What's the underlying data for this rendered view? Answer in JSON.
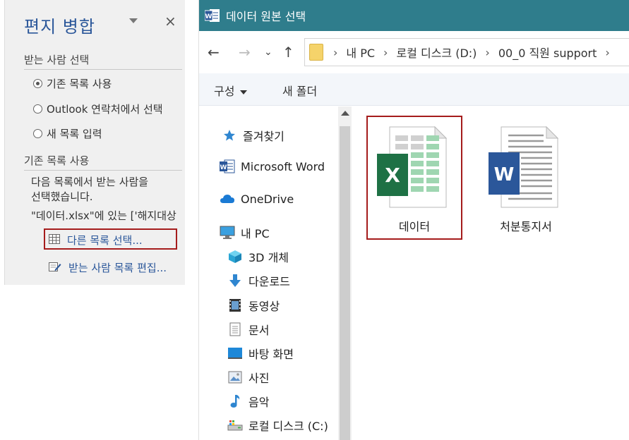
{
  "mail_merge": {
    "title": "편지 병합",
    "close": "×",
    "section_recipients": "받는 사람 선택",
    "options": [
      {
        "label": "기존 목록 사용",
        "selected": true
      },
      {
        "label": "Outlook 연락처에서 선택",
        "selected": false
      },
      {
        "label": "새 목록 입력",
        "selected": false
      }
    ],
    "section_existing": "기존 목록 사용",
    "desc_line1": "다음 목록에서 받는 사람을",
    "desc_line2": "선택했습니다.",
    "desc_line3": "\"데이터.xlsx\"에 있는 ['해지대상",
    "link_select": "다른 목록 선택...",
    "link_edit": "받는 사람 목록 편집..."
  },
  "dialog": {
    "title": "데이터 원본 선택",
    "path": [
      "내 PC",
      "로컬 디스크 (D:)",
      "00_0 직원 support"
    ],
    "toolbar": {
      "organize": "구성",
      "new_folder": "새 폴더"
    },
    "nav": [
      {
        "label": "즐겨찾기",
        "icon": "star-icon"
      },
      {
        "label": "Microsoft Word",
        "icon": "word-icon"
      },
      {
        "label": "OneDrive",
        "icon": "cloud-icon"
      },
      {
        "label": "내 PC",
        "icon": "pc-icon"
      },
      {
        "label": "3D 개체",
        "icon": "cube-icon"
      },
      {
        "label": "다운로드",
        "icon": "download-icon"
      },
      {
        "label": "동영상",
        "icon": "video-icon"
      },
      {
        "label": "문서",
        "icon": "document-icon"
      },
      {
        "label": "바탕 화면",
        "icon": "desktop-icon"
      },
      {
        "label": "사진",
        "icon": "picture-icon"
      },
      {
        "label": "음악",
        "icon": "music-icon"
      },
      {
        "label": "로컬 디스크 (C:)",
        "icon": "drive-icon"
      }
    ],
    "files": [
      {
        "label": "데이터",
        "type": "excel",
        "selected": true
      },
      {
        "label": "처분통지서",
        "type": "word",
        "selected": false
      }
    ]
  },
  "colors": {
    "title_bar": "#2f7d8c",
    "highlight": "#a51c1c",
    "excel_green": "#1e7145",
    "word_blue": "#2b579a"
  }
}
